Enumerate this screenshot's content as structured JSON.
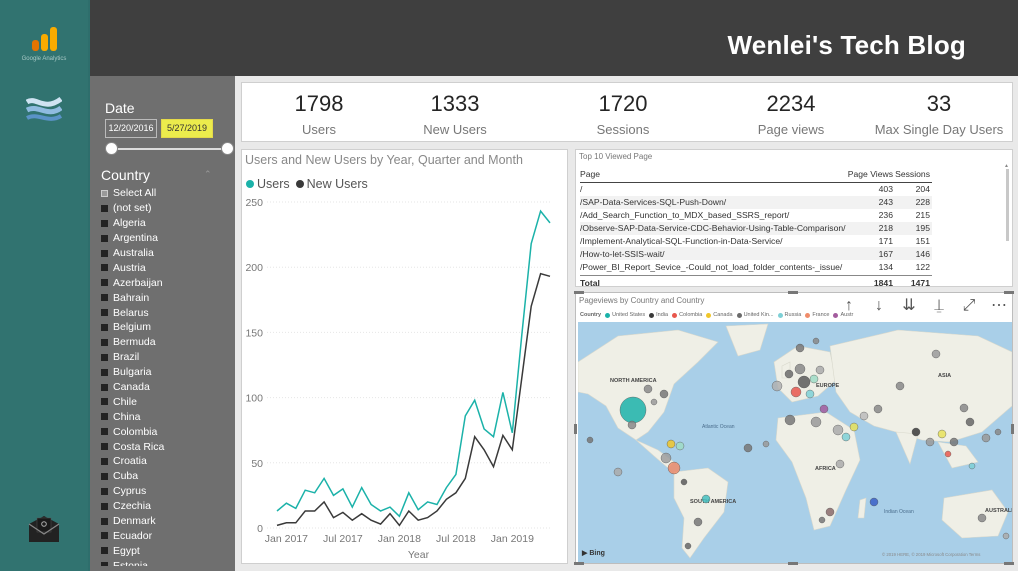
{
  "rail": {
    "ga_text": "Google Analytics"
  },
  "header": {
    "title": "Wenlei's Tech Blog"
  },
  "slicer": {
    "date_label": "Date",
    "date_start": "12/20/2016",
    "date_end": "5/27/2019",
    "country_label": "Country",
    "countries": [
      "Select All",
      "(not set)",
      "Algeria",
      "Argentina",
      "Australia",
      "Austria",
      "Azerbaijan",
      "Bahrain",
      "Belarus",
      "Belgium",
      "Bermuda",
      "Brazil",
      "Bulgaria",
      "Canada",
      "Chile",
      "China",
      "Colombia",
      "Costa Rica",
      "Croatia",
      "Cuba",
      "Cyprus",
      "Czechia",
      "Denmark",
      "Ecuador",
      "Egypt",
      "Estonia"
    ]
  },
  "kpis": [
    {
      "value": "1798",
      "label": "Users"
    },
    {
      "value": "1333",
      "label": "New Users"
    },
    {
      "value": "1720",
      "label": "Sessions"
    },
    {
      "value": "2234",
      "label": "Page views"
    },
    {
      "value": "33",
      "label": "Max Single Day Users"
    }
  ],
  "line_chart": {
    "title": "Users and New Users by Year, Quarter and Month",
    "legend": [
      "Users",
      "New Users"
    ]
  },
  "chart_data": {
    "type": "line",
    "xlabel": "Year",
    "ylabel": "",
    "ylim": [
      0,
      250
    ],
    "yticks": [
      0,
      50,
      100,
      150,
      200,
      250
    ],
    "xtick_labels": [
      "Jan 2017",
      "Jul 2017",
      "Jan 2018",
      "Jul 2018",
      "Jan 2019"
    ],
    "x": [
      "2016-12",
      "2017-01",
      "2017-02",
      "2017-03",
      "2017-04",
      "2017-05",
      "2017-06",
      "2017-07",
      "2017-08",
      "2017-09",
      "2017-10",
      "2017-11",
      "2017-12",
      "2018-01",
      "2018-02",
      "2018-03",
      "2018-04",
      "2018-05",
      "2018-06",
      "2018-07",
      "2018-08",
      "2018-09",
      "2018-10",
      "2018-11",
      "2018-12",
      "2019-01",
      "2019-02",
      "2019-03",
      "2019-04",
      "2019-05"
    ],
    "series": [
      {
        "name": "Users",
        "color": "#1bb2a9",
        "values": [
          13,
          19,
          15,
          29,
          27,
          38,
          25,
          30,
          16,
          31,
          18,
          13,
          16,
          9,
          27,
          14,
          20,
          18,
          31,
          41,
          86,
          98,
          76,
          70,
          104,
          73,
          148,
          218,
          243,
          234
        ]
      },
      {
        "name": "New Users",
        "color": "#3a3a3a",
        "values": [
          2,
          4,
          4,
          13,
          13,
          20,
          8,
          12,
          6,
          11,
          6,
          3,
          11,
          2,
          13,
          6,
          8,
          13,
          22,
          27,
          38,
          70,
          60,
          47,
          71,
          60,
          115,
          170,
          195,
          193
        ]
      }
    ]
  },
  "top_pages": {
    "title": "Top 10 Viewed Page",
    "headers": [
      "Page",
      "Page Views",
      "Sessions"
    ],
    "rows": [
      [
        "/",
        "403",
        "204"
      ],
      [
        "/SAP-Data-Services-SQL-Push-Down/",
        "243",
        "228"
      ],
      [
        "/Add_Search_Function_to_MDX_based_SSRS_report/",
        "236",
        "215"
      ],
      [
        "/Observe-SAP-Data-Service-CDC-Behavior-Using-Table-Comparison/",
        "218",
        "195"
      ],
      [
        "/Implement-Analytical-SQL-Function-in-Data-Service/",
        "171",
        "151"
      ],
      [
        "/How-to-let-SSIS-wait/",
        "167",
        "146"
      ],
      [
        "/Power_BI_Report_Sevice_-Could_not_load_folder_contents-_issue/",
        "134",
        "122"
      ]
    ],
    "total": [
      "Total",
      "1841",
      "1471"
    ]
  },
  "map": {
    "title": "Pageviews by Country and Country",
    "legend_label": "Country",
    "legend": [
      {
        "name": "United States",
        "color": "#1bb2a9"
      },
      {
        "name": "India",
        "color": "#3a3a3a"
      },
      {
        "name": "Colombia",
        "color": "#e8574d"
      },
      {
        "name": "Canada",
        "color": "#f0c629"
      },
      {
        "name": "United Kin...",
        "color": "#6b6b6b"
      },
      {
        "name": "Russia",
        "color": "#7ed0d6"
      },
      {
        "name": "France",
        "color": "#f08c6a"
      },
      {
        "name": "Austr",
        "color": "#a35c9e"
      }
    ],
    "labels": {
      "north_america": "NORTH AMERICA",
      "europe": "EUROPE",
      "asia": "ASIA",
      "africa": "AFRICA",
      "south_america": "SOUTH AMERICA",
      "australia": "AUSTRALIA",
      "atlantic": "Atlantic Ocean",
      "indian": "Indian Ocean"
    },
    "bing": "Bing",
    "copyright": "© 2019 HERE, © 2019 Microsoft Corporation  Terms"
  }
}
